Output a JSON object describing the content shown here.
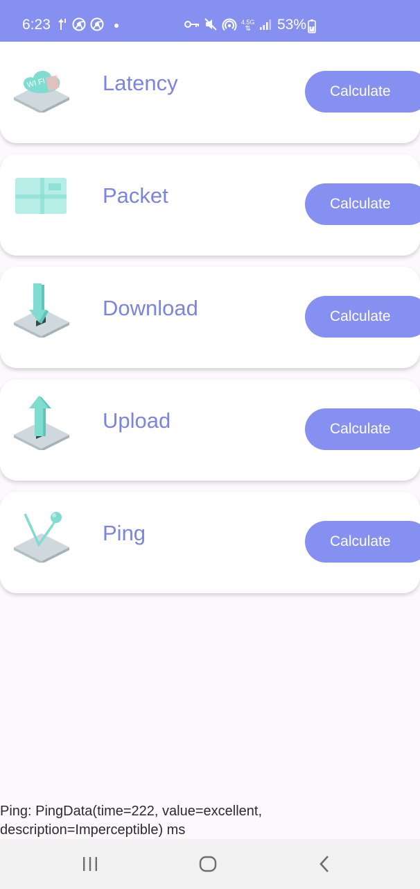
{
  "status_bar": {
    "time": "6:23",
    "network_type": "4.5G",
    "battery_percent": "53%",
    "background_color": "#8590f1",
    "left_icons": [
      "data-transfer-icon",
      "chrome-icon",
      "chrome-icon",
      "notification-dot-icon"
    ],
    "right_icons": [
      "vpn-key-icon",
      "mute-icon",
      "hotspot-icon",
      "network-type-icon",
      "signal-icon",
      "battery-icon"
    ]
  },
  "cards": [
    {
      "title": "Latency",
      "button_label": "Calculate",
      "icon": "wifi-cloud-icon"
    },
    {
      "title": "Packet",
      "button_label": "Calculate",
      "icon": "packet-grid-icon"
    },
    {
      "title": "Download",
      "button_label": "Calculate",
      "icon": "download-arrow-icon"
    },
    {
      "title": "Upload",
      "button_label": "Calculate",
      "icon": "upload-arrow-icon"
    },
    {
      "title": "Ping",
      "button_label": "Calculate",
      "icon": "ping-chart-icon"
    }
  ],
  "result": {
    "text": "Ping: PingData(time=222, value=excellent,\ndescription=Imperceptible) ms"
  },
  "nav_bar": {
    "buttons": [
      "recent-apps-icon",
      "home-icon",
      "back-icon"
    ]
  },
  "colors": {
    "accent": "#8590f1",
    "title": "#7b84e0",
    "icon_teal": "#7fdcd0",
    "icon_base": "#cfd8dc",
    "card_background": "#ffffff",
    "page_background": "#fcf8fd"
  }
}
